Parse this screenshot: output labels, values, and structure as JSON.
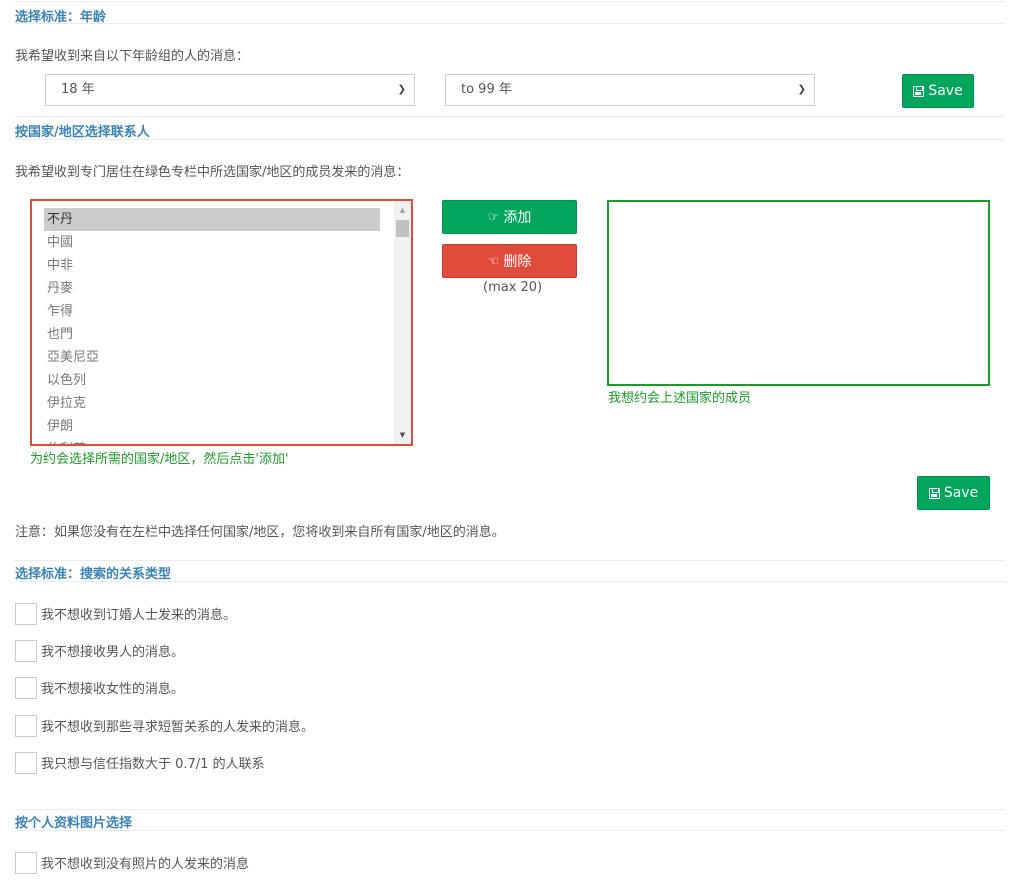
{
  "age_section": {
    "title": "选择标准：年龄",
    "description": "我希望收到来自以下年龄组的人的消息：",
    "from_select": {
      "value": "18 年"
    },
    "to_select": {
      "value": "to 99 年"
    },
    "save_label": "Save"
  },
  "country_section": {
    "title": "按国家/地区选择联系人",
    "description": "我希望收到专门居住在绿色专栏中所选国家/地区的成员发来的消息：",
    "available_countries": [
      {
        "label": "不丹",
        "selected": true
      },
      {
        "label": "中國",
        "selected": false
      },
      {
        "label": "中非",
        "selected": false
      },
      {
        "label": "丹麥",
        "selected": false
      },
      {
        "label": "乍得",
        "selected": false
      },
      {
        "label": "也門",
        "selected": false
      },
      {
        "label": "亞美尼亞",
        "selected": false
      },
      {
        "label": "以色列",
        "selected": false
      },
      {
        "label": "伊拉克",
        "selected": false
      },
      {
        "label": "伊朗",
        "selected": false
      },
      {
        "label": "伯利茲",
        "selected": false
      }
    ],
    "available_hint": "为约会选择所需的国家/地区，然后点击'添加'",
    "add_label": "添加",
    "remove_label": "删除",
    "max_note": "(max 20)",
    "selected_countries": [],
    "selected_hint": "我想约会上述国家的成员",
    "save_label": "Save",
    "note": "注意：如果您没有在左栏中选择任何国家/地区，您将收到来自所有国家/地区的消息。"
  },
  "relationship_section": {
    "title": "选择标准：搜索的关系类型",
    "options": [
      {
        "label": "我不想收到订婚人士发来的消息。",
        "checked": false
      },
      {
        "label": "我不想接收男人的消息。",
        "checked": false
      },
      {
        "label": "我不想接收女性的消息。",
        "checked": false
      },
      {
        "label": "我不想收到那些寻求短暂关系的人发来的消息。",
        "checked": false
      },
      {
        "label": "我只想与信任指数大于 0.7/1 的人联系",
        "checked": false
      }
    ]
  },
  "photo_section": {
    "title": "按个人资料图片选择",
    "options": [
      {
        "label": "我不想收到没有照片的人发来的消息",
        "checked": false
      }
    ]
  },
  "colors": {
    "accent_green": "#01a55b",
    "danger_red": "#e14b3b",
    "title_blue": "#3c83b5",
    "box_green": "#1f9a2a"
  }
}
